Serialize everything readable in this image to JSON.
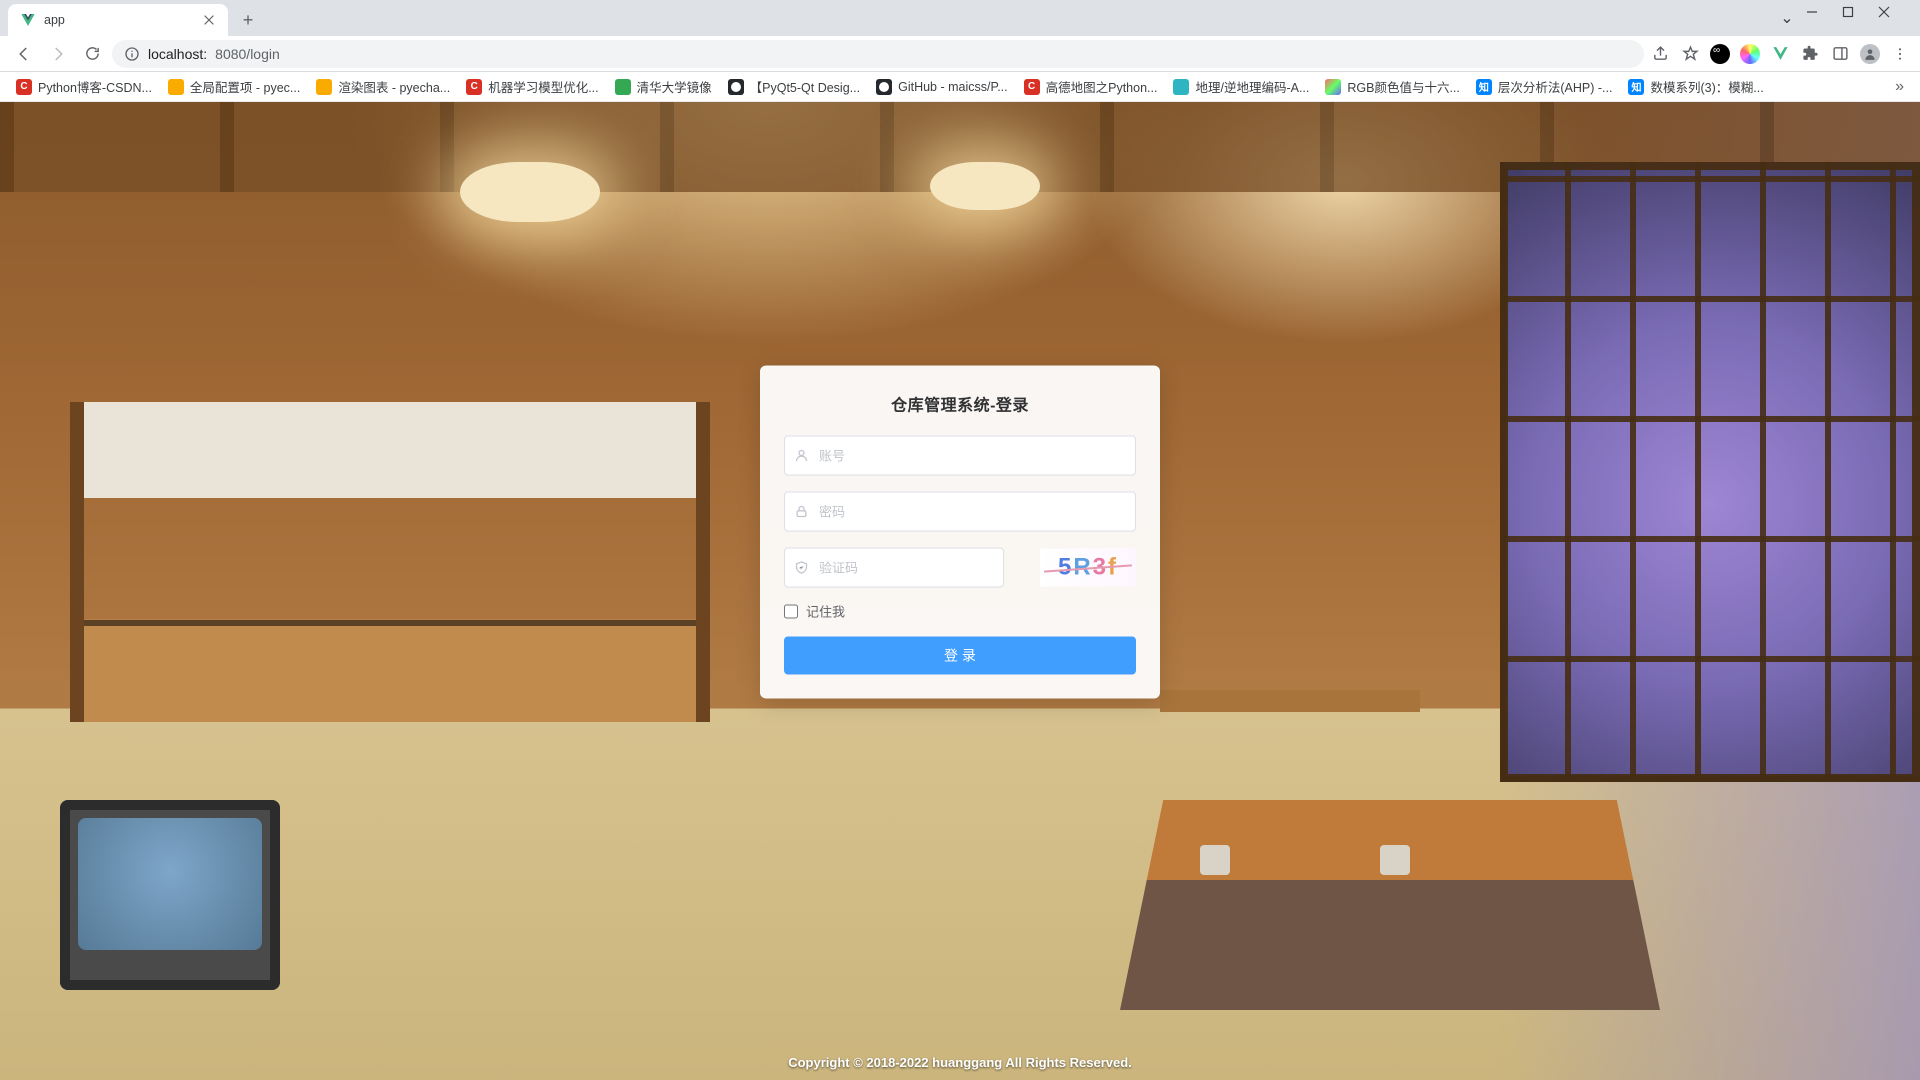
{
  "browser": {
    "tab_title": "app",
    "url_host": "localhost:",
    "url_port_path": "8080/login"
  },
  "bookmarks": [
    {
      "icon": "bm-red",
      "label": "Python博客-CSDN..."
    },
    {
      "icon": "bm-yellow",
      "label": "全局配置项 - pyec..."
    },
    {
      "icon": "bm-yellow",
      "label": "渲染图表 - pyecha..."
    },
    {
      "icon": "bm-red",
      "label": "机器学习模型优化..."
    },
    {
      "icon": "bm-green",
      "label": "清华大学镜像"
    },
    {
      "icon": "bm-black",
      "label": "【PyQt5-Qt Desig..."
    },
    {
      "icon": "bm-black",
      "label": "GitHub - maicss/P..."
    },
    {
      "icon": "bm-red",
      "label": "高德地图之Python..."
    },
    {
      "icon": "bm-teal",
      "label": "地理/逆地理编码-A..."
    },
    {
      "icon": "bm-rainbow",
      "label": "RGB颜色值与十六..."
    },
    {
      "icon": "bm-zhi",
      "label": "层次分析法(AHP) -..."
    },
    {
      "icon": "bm-zhi",
      "label": "数模系列(3)：模糊..."
    }
  ],
  "login": {
    "title": "仓库管理系统-登录",
    "username_placeholder": "账号",
    "password_placeholder": "密码",
    "captcha_placeholder": "验证码",
    "captcha_chars": [
      "5",
      "R",
      "3",
      "f"
    ],
    "remember_label": "记住我",
    "submit_label": "登 录"
  },
  "footer": "Copyright © 2018-2022 huanggang All Rights Reserved."
}
